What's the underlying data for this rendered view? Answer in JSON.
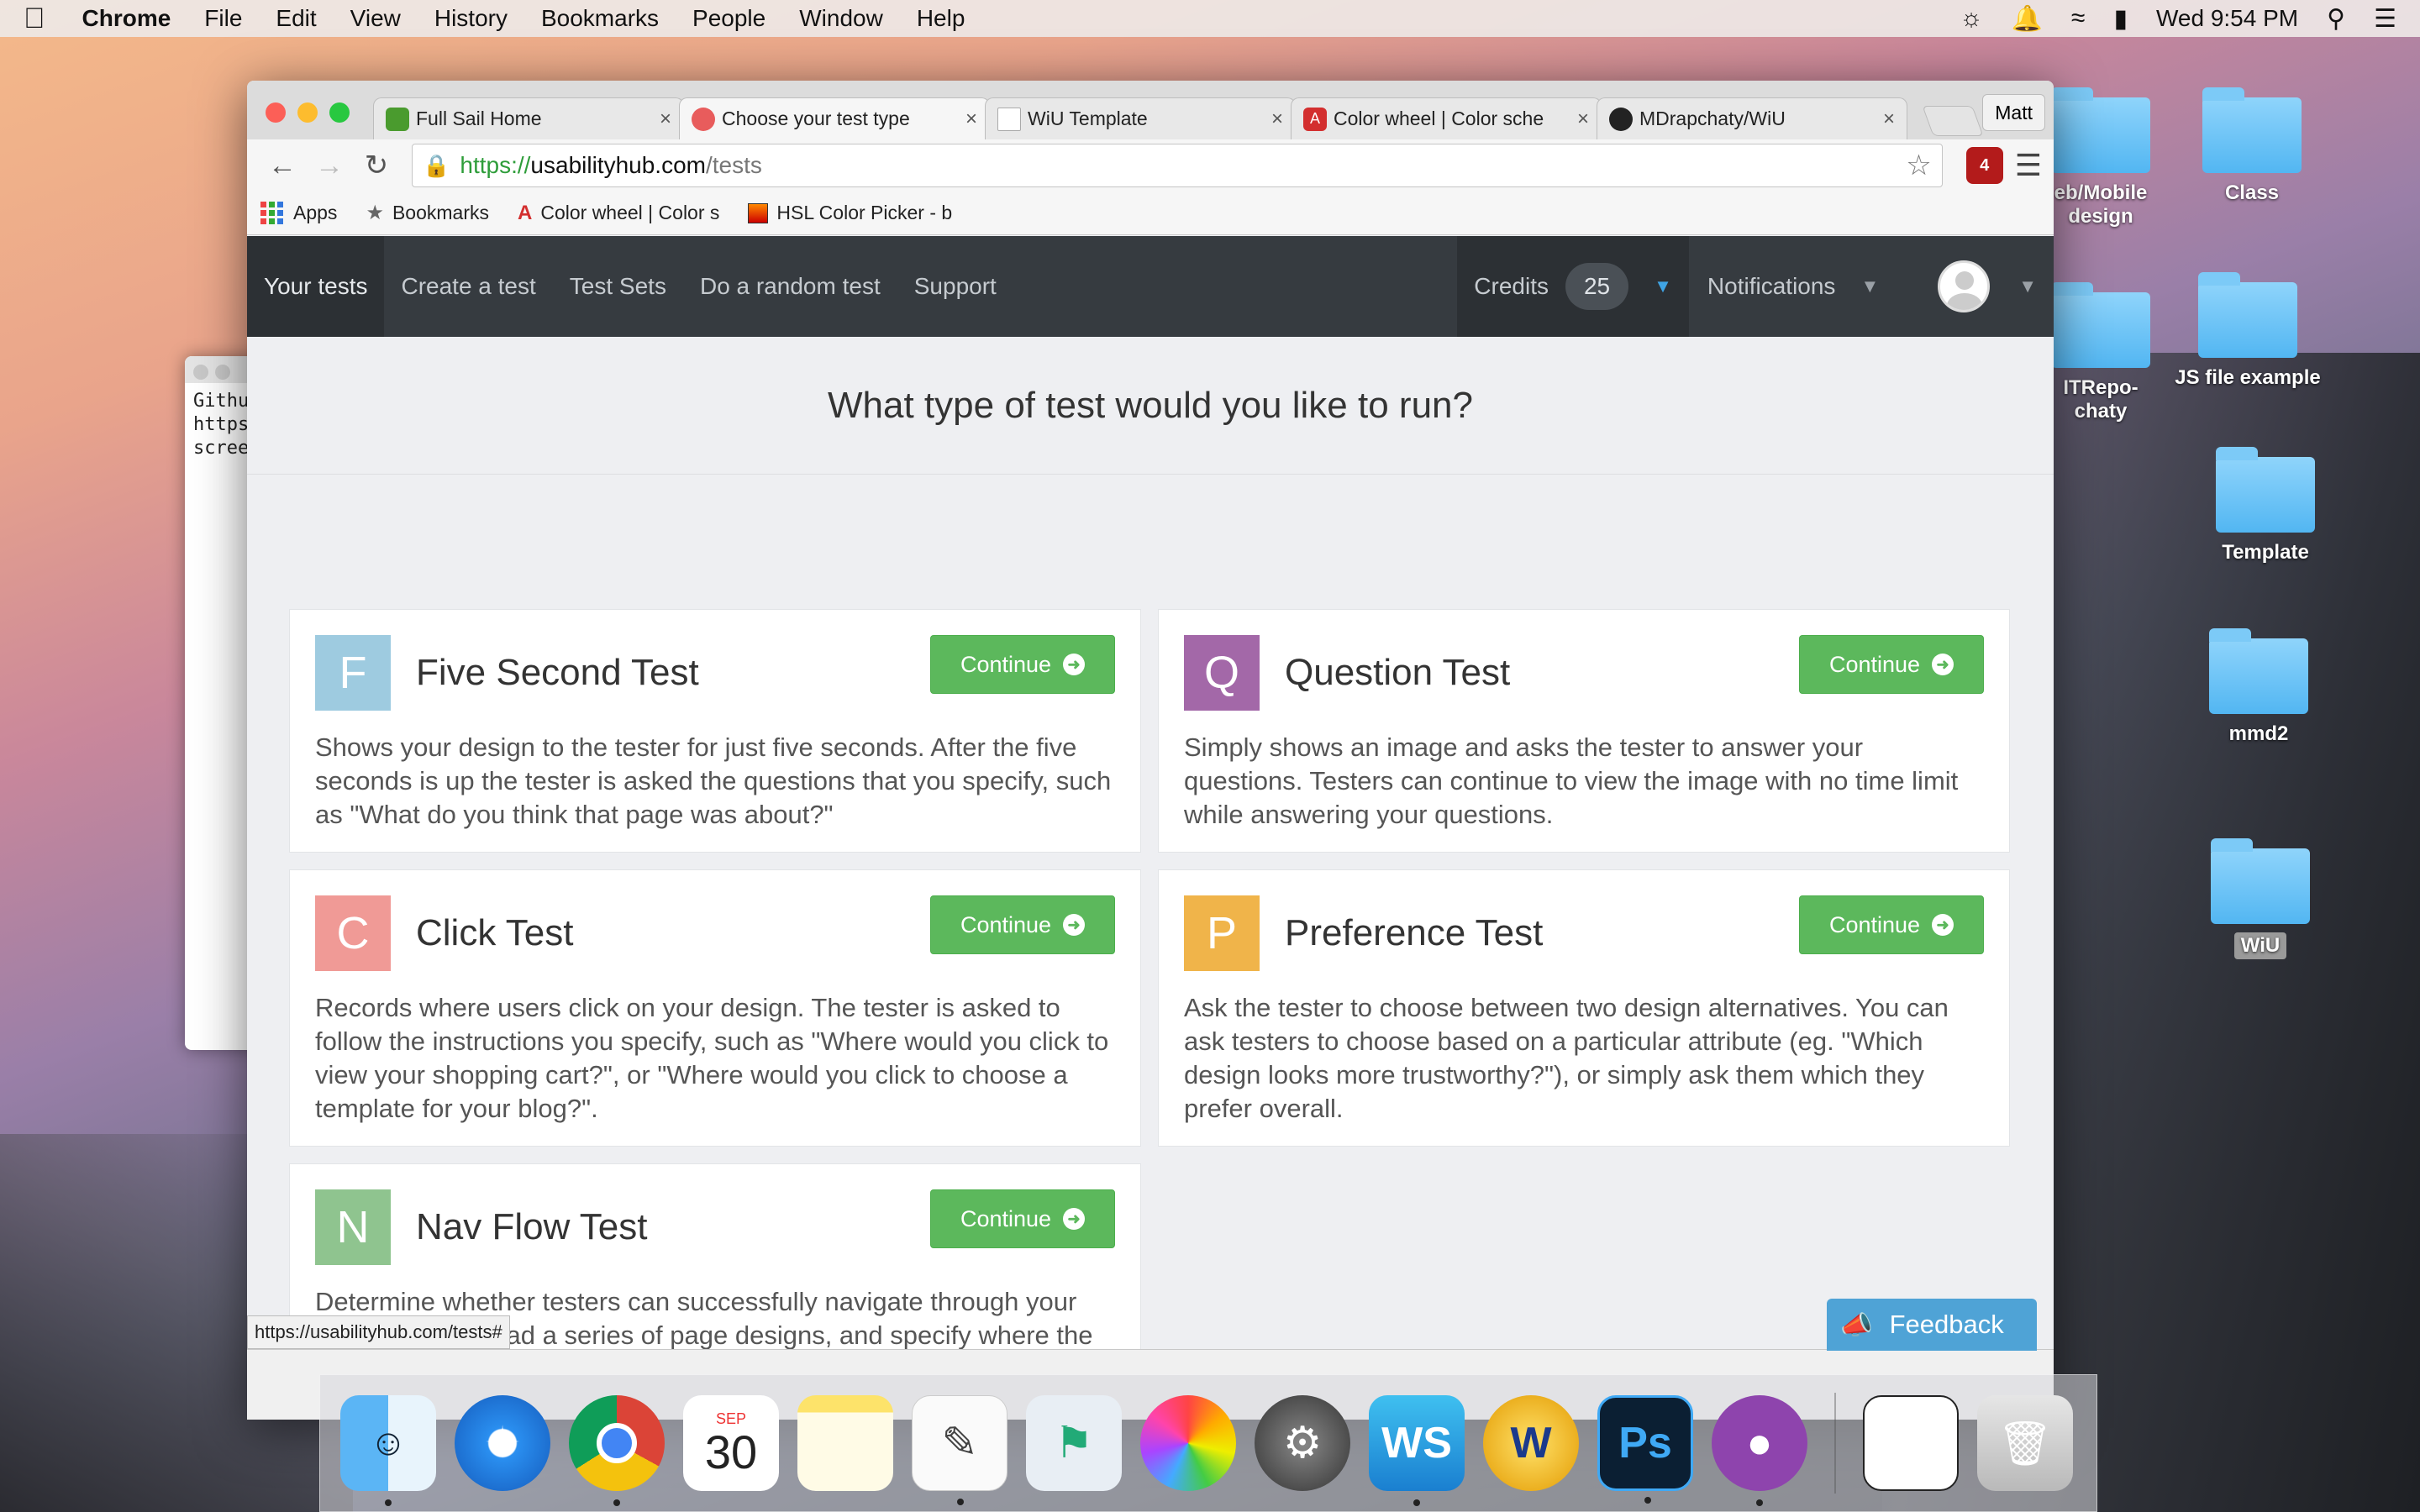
{
  "menubar": {
    "app": "Chrome",
    "items": [
      "File",
      "Edit",
      "View",
      "History",
      "Bookmarks",
      "People",
      "Window",
      "Help"
    ],
    "clock": "Wed 9:54 PM"
  },
  "desktop": {
    "icons": [
      {
        "label": "eb/Mobile\ndesign"
      },
      {
        "label": "Class"
      },
      {
        "label": "JS file example"
      },
      {
        "label": "ITRepo-\nchaty"
      },
      {
        "label": "Template"
      },
      {
        "label": "mmd2"
      },
      {
        "label": "WiU"
      }
    ]
  },
  "terminal": {
    "lines": [
      "Githu",
      "https",
      "",
      "scree"
    ]
  },
  "browser": {
    "tabs": [
      {
        "title": "Full Sail Home",
        "fav_color": "#4a9b2e"
      },
      {
        "title": "Choose your test type",
        "fav_color": "#e85c5c"
      },
      {
        "title": "WiU Template",
        "fav_color": "#ffffff"
      },
      {
        "title": "Color wheel | Color sche",
        "fav_color": "#d32f2f"
      },
      {
        "title": "MDrapchaty/WiU",
        "fav_color": "#222222"
      }
    ],
    "profile": "Matt",
    "url": {
      "scheme": "https://",
      "host": "usabilityhub.com",
      "path": "/tests"
    },
    "extension_badge": "4",
    "bookmarks": [
      {
        "label": "Apps"
      },
      {
        "label": "Bookmarks"
      },
      {
        "label": "Color wheel | Color s"
      },
      {
        "label": "HSL Color Picker - b"
      }
    ],
    "status_url": "https://usabilityhub.com/tests#"
  },
  "site": {
    "nav": [
      "Your tests",
      "Create a test",
      "Test Sets",
      "Do a random test",
      "Support"
    ],
    "credits_label": "Credits",
    "credits_value": "25",
    "notifications_label": "Notifications",
    "heading": "What type of test would you like to run?",
    "continue_label": "Continue",
    "feedback_label": "Feedback",
    "tests": [
      {
        "letter": "F",
        "color": "#9ecbe0",
        "title": "Five Second Test",
        "desc": "Shows your design to the tester for just five seconds. After the five seconds is up the tester is asked the questions that you specify, such as \"What do you think that page was about?\""
      },
      {
        "letter": "Q",
        "color": "#a368a8",
        "title": "Question Test",
        "desc": "Simply shows an image and asks the tester to answer your questions. Testers can continue to view the image with no time limit while answering your questions."
      },
      {
        "letter": "C",
        "color": "#f09a96",
        "title": "Click Test",
        "desc": "Records where users click on your design. The tester is asked to follow the instructions you specify, such as \"Where would you click to view your shopping cart?\", or \"Where would you click to choose a template for your blog?\"."
      },
      {
        "letter": "P",
        "color": "#f0b44a",
        "title": "Preference Test",
        "desc": "Ask the tester to choose between two design alternatives. You can ask testers to choose based on a particular attribute (eg. \"Which design looks more trustworthy?\"), or simply ask them which they prefer overall."
      },
      {
        "letter": "N",
        "color": "#8fc48f",
        "title": "Nav Flow Test",
        "desc": "Determine whether testers can successfully navigate through your design. You upload a series of page designs, and specify where the tester has to click to proceed. The success and failure"
      }
    ]
  },
  "dock": {
    "calendar_month": "SEP",
    "calendar_day": "30",
    "ps_label": "Ps"
  }
}
